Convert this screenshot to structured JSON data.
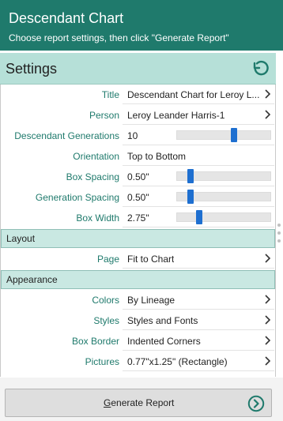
{
  "header": {
    "title": "Descendant Chart",
    "subtitle": "Choose report settings, then click \"Generate Report\""
  },
  "settings": {
    "label": "Settings",
    "reset_icon": "reset-icon",
    "rows": {
      "title": {
        "label": "Title",
        "value": "Descendant Chart for Leroy L..."
      },
      "person": {
        "label": "Person",
        "value": "Leroy Leander Harris-1"
      },
      "generations": {
        "label": "Descendant Generations",
        "value": "10",
        "slider_level": 0.62
      },
      "orientation": {
        "label": "Orientation",
        "value": "Top to Bottom"
      },
      "box_spacing": {
        "label": "Box Spacing",
        "value": "0.50\"",
        "slider_level": 0.12
      },
      "gen_spacing": {
        "label": "Generation Spacing",
        "value": "0.50\"",
        "slider_level": 0.12
      },
      "box_width": {
        "label": "Box Width",
        "value": "2.75\"",
        "slider_level": 0.22
      }
    }
  },
  "layout": {
    "label": "Layout",
    "page": {
      "label": "Page",
      "value": "Fit to Chart"
    }
  },
  "appearance": {
    "label": "Appearance",
    "colors": {
      "label": "Colors",
      "value": "By Lineage"
    },
    "styles": {
      "label": "Styles",
      "value": "Styles and Fonts"
    },
    "box_border": {
      "label": "Box Border",
      "value": "Indented Corners"
    },
    "pictures": {
      "label": "Pictures",
      "value": "0.77\"x1.25\" (Rectangle)"
    }
  },
  "footer": {
    "generate_label_accel": "G",
    "generate_label_rest": "enerate Report"
  },
  "colors": {
    "accent": "#1f7a6c",
    "section_bg": "#c9e8e2",
    "slider_thumb": "#1e6fd0"
  }
}
